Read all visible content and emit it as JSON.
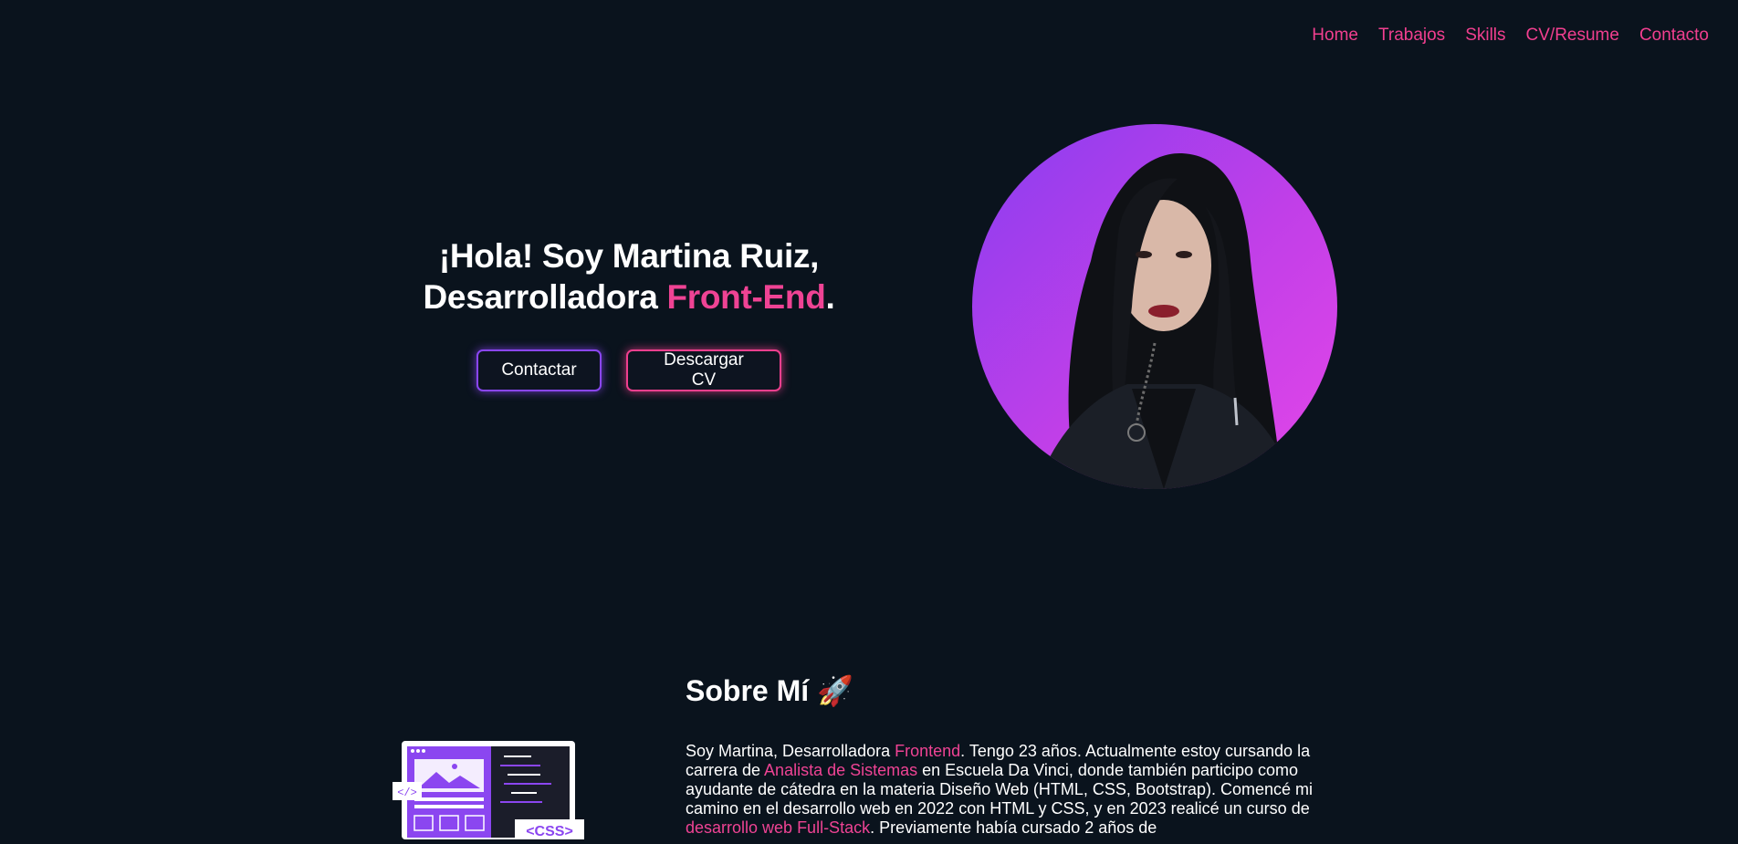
{
  "nav": {
    "items": [
      {
        "label": "Home"
      },
      {
        "label": "Trabajos"
      },
      {
        "label": "Skills"
      },
      {
        "label": "CV/Resume"
      },
      {
        "label": "Contacto"
      }
    ]
  },
  "hero": {
    "line1": "¡Hola! Soy Martina Ruiz,",
    "line2_prefix": "Desarrolladora ",
    "line2_accent": "Front-End",
    "line2_suffix": ".",
    "contact_label": "Contactar",
    "cv_label": "Descargar CV"
  },
  "about": {
    "title": "Sobre Mí 🚀",
    "p_1": "Soy Martina, Desarrolladora ",
    "p_2": "Frontend",
    "p_3": ". Tengo 23 años. Actualmente estoy cursando la carrera de ",
    "p_4": "Analista de Sistemas",
    "p_5": " en Escuela Da Vinci, donde también participo como ayudante de cátedra en la materia Diseño Web (HTML, CSS, Bootstrap). Comencé mi camino en el desarrollo web en 2022 con HTML y CSS, y en 2023 realicé un curso de ",
    "p_6": "desarrollo web Full-Stack",
    "p_7": ". Previamente había cursado 2 años de"
  },
  "illustration": {
    "tag_code": "</>",
    "tag_css": "<CSS>"
  },
  "colors": {
    "background": "#0a131d",
    "accent_pink": "#ef4394",
    "accent_purple": "#8a46f3"
  },
  "icons": {
    "rocket": "rocket-icon"
  }
}
